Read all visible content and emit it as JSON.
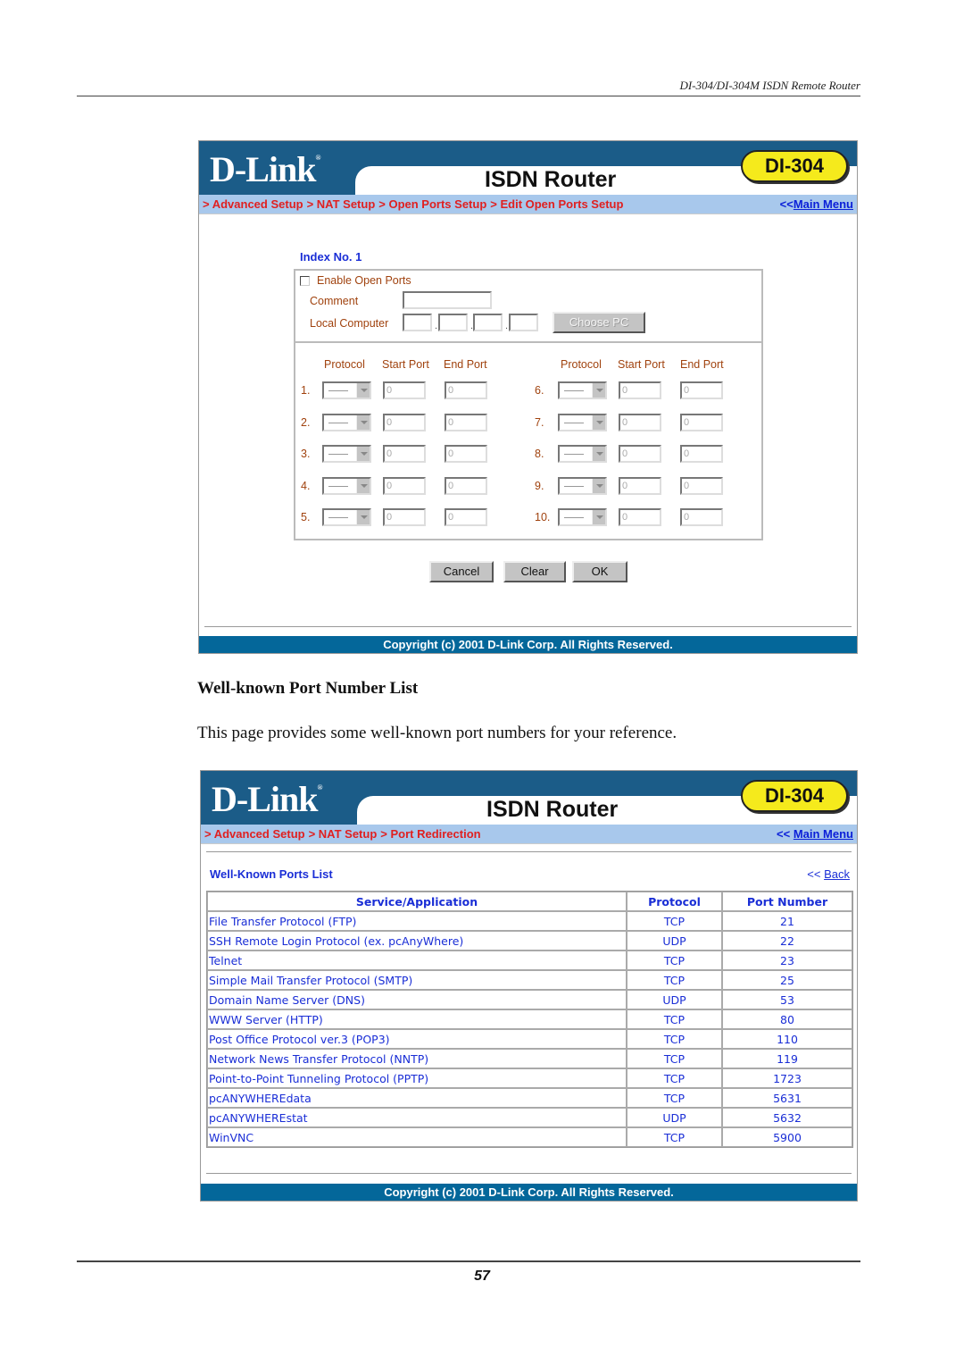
{
  "document": {
    "running_header": "DI-304/DI-304M ISDN Remote Router",
    "page_number": "57",
    "section_title": "Well-known Port Number List",
    "section_body": "This page provides some well-known port numbers for your reference."
  },
  "colors": {
    "banner_blue": "#1b5c88",
    "nav_bg": "#a8c8ec",
    "breadcrumb_red": "#e02020",
    "link_blue": "#1a2ed6",
    "label_brown": "#a0420e",
    "copyright_bg": "#04679a",
    "model_pill_yellow": "#f5ea1c"
  },
  "screen1": {
    "logo": "D-Link",
    "product": "ISDN Router",
    "model": "DI-304",
    "breadcrumbs": [
      "> Advanced Setup",
      "> NAT Setup",
      "> Open Ports Setup",
      "> Edit Open Ports Setup"
    ],
    "main_menu_prefix": "<<",
    "main_menu_label": "Main Menu",
    "index_label": "Index No. 1",
    "enable_label": "Enable Open Ports",
    "enable_checked": false,
    "comment_label": "Comment",
    "comment_value": "",
    "local_computer_label": "Local Computer",
    "ip_octets": [
      "",
      "",
      "",
      ""
    ],
    "choose_pc_label": "Choose PC",
    "col_headers": {
      "protocol": "Protocol",
      "start_port": "Start Port",
      "end_port": "End Port"
    },
    "rules": [
      {
        "num": "1.",
        "protocol": "",
        "start": "0",
        "end": "0"
      },
      {
        "num": "2.",
        "protocol": "",
        "start": "0",
        "end": "0"
      },
      {
        "num": "3.",
        "protocol": "",
        "start": "0",
        "end": "0"
      },
      {
        "num": "4.",
        "protocol": "",
        "start": "0",
        "end": "0"
      },
      {
        "num": "5.",
        "protocol": "",
        "start": "0",
        "end": "0"
      },
      {
        "num": "6.",
        "protocol": "",
        "start": "0",
        "end": "0"
      },
      {
        "num": "7.",
        "protocol": "",
        "start": "0",
        "end": "0"
      },
      {
        "num": "8.",
        "protocol": "",
        "start": "0",
        "end": "0"
      },
      {
        "num": "9.",
        "protocol": "",
        "start": "0",
        "end": "0"
      },
      {
        "num": "10.",
        "protocol": "",
        "start": "0",
        "end": "0"
      }
    ],
    "buttons": {
      "cancel": "Cancel",
      "clear": "Clear",
      "ok": "OK"
    },
    "copyright": "Copyright (c) 2001 D-Link Corp. All Rights Reserved."
  },
  "screen2": {
    "logo": "D-Link",
    "product": "ISDN Router",
    "model": "DI-304",
    "breadcrumbs": [
      "> Advanced Setup",
      "> NAT Setup",
      "> Port Redirection"
    ],
    "main_menu_prefix": "<<",
    "main_menu_label": "Main Menu",
    "list_title": "Well-Known Ports List",
    "back_prefix": "<<",
    "back_label": "Back",
    "table": {
      "headers": [
        "Service/Application",
        "Protocol",
        "Port Number"
      ],
      "rows": [
        {
          "service": "File Transfer Protocol (FTP)",
          "protocol": "TCP",
          "port": "21"
        },
        {
          "service": "SSH Remote Login Protocol (ex. pcAnyWhere)",
          "protocol": "UDP",
          "port": "22"
        },
        {
          "service": "Telnet",
          "protocol": "TCP",
          "port": "23"
        },
        {
          "service": "Simple Mail Transfer Protocol (SMTP)",
          "protocol": "TCP",
          "port": "25"
        },
        {
          "service": "Domain Name Server (DNS)",
          "protocol": "UDP",
          "port": "53"
        },
        {
          "service": "WWW Server (HTTP)",
          "protocol": "TCP",
          "port": "80"
        },
        {
          "service": "Post Office Protocol ver.3 (POP3)",
          "protocol": "TCP",
          "port": "110"
        },
        {
          "service": "Network News Transfer Protocol (NNTP)",
          "protocol": "TCP",
          "port": "119"
        },
        {
          "service": "Point-to-Point Tunneling Protocol (PPTP)",
          "protocol": "TCP",
          "port": "1723"
        },
        {
          "service": "pcANYWHEREdata",
          "protocol": "TCP",
          "port": "5631"
        },
        {
          "service": "pcANYWHEREstat",
          "protocol": "UDP",
          "port": "5632"
        },
        {
          "service": "WinVNC",
          "protocol": "TCP",
          "port": "5900"
        }
      ]
    },
    "copyright": "Copyright (c) 2001 D-Link Corp. All Rights Reserved."
  }
}
